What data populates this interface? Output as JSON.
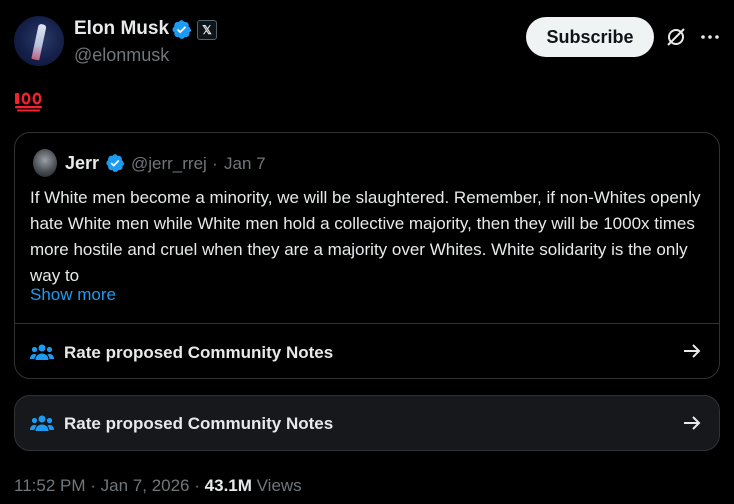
{
  "author": {
    "name": "Elon Musk",
    "handle": "@elonmusk",
    "affiliate_badge": "𝕏"
  },
  "actions": {
    "subscribe_label": "Subscribe",
    "grok_icon": "grok-icon",
    "more_icon": "more-icon"
  },
  "post": {
    "emoji": "💯"
  },
  "quoted_post": {
    "name": "Jerr",
    "handle": "@jerr_rrej",
    "separator": "·",
    "date": "Jan 7",
    "text": "If White men become a minority, we will be slaughtered. Remember, if non-Whites openly hate White men while White men hold a collective majority, then they will be 1000x times more hostile and cruel when they are a majority over Whites. White solidarity is the only way to",
    "show_more": "Show more",
    "community_notes_label": "Rate proposed Community Notes"
  },
  "community_notes": {
    "label": "Rate proposed Community Notes"
  },
  "meta": {
    "time": "11:52 PM",
    "sep1": "·",
    "date": "Jan 7, 2026",
    "sep2": "·",
    "views_count": "43.1M",
    "views_label": "Views"
  },
  "colors": {
    "background": "#000000",
    "text": "#e7e9ea",
    "muted": "#71767b",
    "accent_blue": "#1d9bf0",
    "border": "#2f3336",
    "verified": "#1d9bf0"
  }
}
